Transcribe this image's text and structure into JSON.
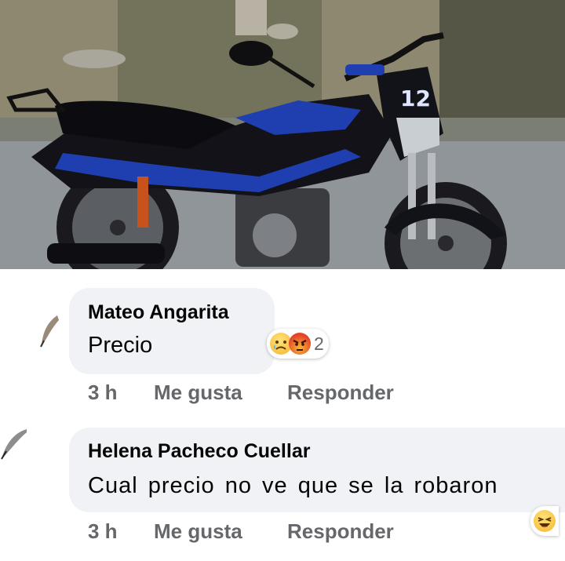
{
  "comments": [
    {
      "author": "Mateo Angarita",
      "text": "Precio",
      "time": "3 h",
      "like_label": "Me gusta",
      "reply_label": "Responder",
      "reaction_count": "2",
      "reactions": [
        "sad-emoji-icon",
        "angry-emoji-icon"
      ]
    },
    {
      "author": "Helena Pacheco Cuellar",
      "text": "Cual precio no ve que se la robaron",
      "time": "3 h",
      "like_label": "Me gusta",
      "reply_label": "Responder",
      "reactions": [
        "laughing-emoji-icon"
      ]
    }
  ],
  "colors": {
    "bubble": "#f0f2f5",
    "meta_text": "#65676b",
    "body_text": "#050505",
    "motorcycle_blue": "#1f3fb0"
  }
}
